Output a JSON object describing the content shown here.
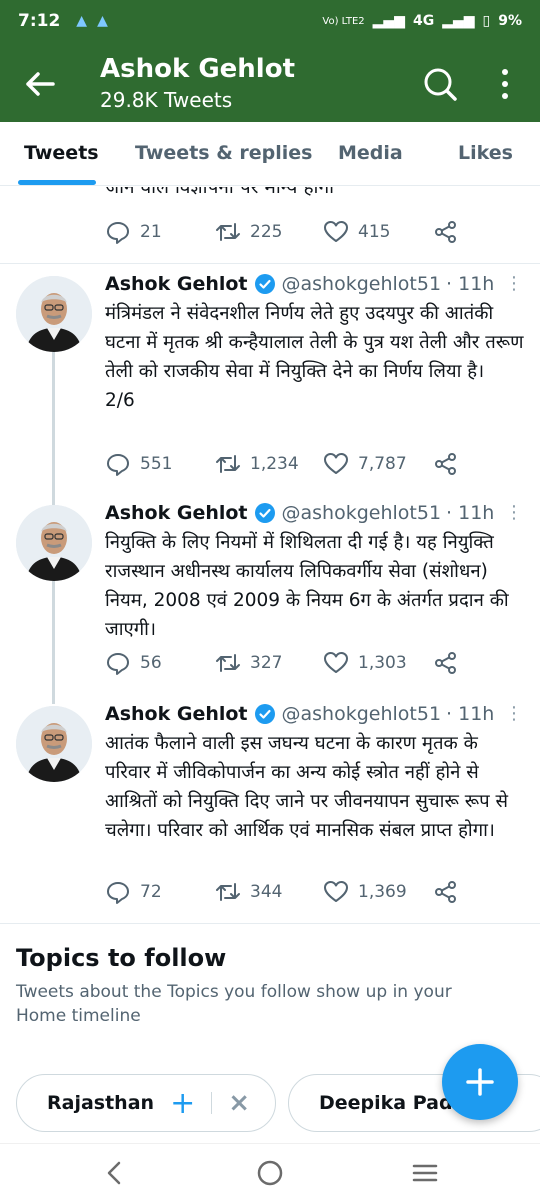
{
  "status_bar": {
    "time": "7:12",
    "icons": [
      "alert-icon",
      "alert-icon"
    ],
    "network_label": "Vo) LTE2",
    "signal_label": "4G",
    "battery": "9%"
  },
  "header": {
    "title": "Ashok Gehlot",
    "subtitle": "29.8K Tweets"
  },
  "tabs": [
    {
      "label": "Tweets",
      "active": true
    },
    {
      "label": "Tweets & replies",
      "active": false
    },
    {
      "label": "Media",
      "active": false
    },
    {
      "label": "Likes",
      "active": false
    }
  ],
  "partial_tweet": {
    "text_fragment": "जाने वाले विज्ञापनों पर मान्य होगा",
    "replies": "21",
    "retweets": "225",
    "likes": "415"
  },
  "tweets": [
    {
      "name": "Ashok Gehlot",
      "handle": "@ashokgehlot51",
      "time": "· 11h",
      "text": "मंत्रिमंडल ने संवेदनशील निर्णय लेते हुए उदयपुर की आतंकी घटना में मृतक श्री कन्हैयालाल तेली के पुत्र यश तेली और तरूण तेली को राजकीय सेवा में नियुक्ति देने का निर्णय लिया है।\n2/6",
      "replies": "551",
      "retweets": "1,234",
      "likes": "7,787"
    },
    {
      "name": "Ashok Gehlot",
      "handle": "@ashokgehlot51",
      "time": "· 11h",
      "text": "नियुक्ति के लिए नियमों में शिथिलता दी गई है। यह नियुक्ति राजस्थान अधीनस्थ कार्यालय लिपिकवर्गीय सेवा (संशोधन) नियम, 2008 एवं 2009 के नियम 6ग के अंतर्गत प्रदान की जाएगी।",
      "replies": "56",
      "retweets": "327",
      "likes": "1,303"
    },
    {
      "name": "Ashok Gehlot",
      "handle": "@ashokgehlot51",
      "time": "· 11h",
      "text": "आतंक फैलाने वाली इस जघन्य घटना के कारण मृतक के परिवार में जीविकोपार्जन का अन्य कोई स्त्रोत नहीं होने से आश्रितों को नियुक्ति दिए जाने पर जीवनयापन सुचारू रूप से चलेगा। परिवार को आर्थिक एवं मानसिक संबल प्राप्त होगा।",
      "replies": "72",
      "retweets": "344",
      "likes": "1,369"
    }
  ],
  "topics": {
    "title": "Topics to follow",
    "description": "Tweets about the Topics you follow show up in your Home timeline",
    "chips": [
      {
        "label": "Rajasthan"
      },
      {
        "label": "Deepika Padu"
      }
    ]
  },
  "colors": {
    "header_bg": "#2f6b30",
    "accent": "#1d9bf0",
    "muted_text": "#536471"
  }
}
